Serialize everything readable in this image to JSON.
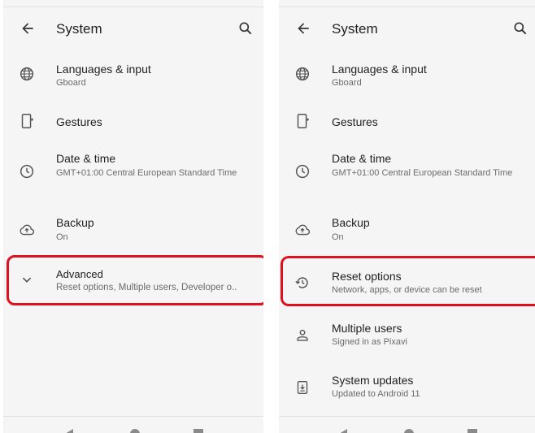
{
  "colors": {
    "highlight": "#e0101f",
    "background": "#f5f5f5",
    "text": "#1f1f1f",
    "subtext": "#6b6b6b"
  },
  "left": {
    "title": "System",
    "items": [
      {
        "icon": "globe-icon",
        "title": "Languages & input",
        "subtitle": "Gboard"
      },
      {
        "icon": "gestures-icon",
        "title": "Gestures",
        "subtitle": ""
      },
      {
        "icon": "clock-icon",
        "title": "Date & time",
        "subtitle": "GMT+01:00 Central European Standard Time"
      },
      {
        "icon": "cloud-upload-icon",
        "title": "Backup",
        "subtitle": "On"
      },
      {
        "icon": "chevron-down-icon",
        "title": "Advanced",
        "subtitle": "Reset options, Multiple users, Developer o.."
      }
    ]
  },
  "right": {
    "title": "System",
    "items": [
      {
        "icon": "globe-icon",
        "title": "Languages & input",
        "subtitle": "Gboard"
      },
      {
        "icon": "gestures-icon",
        "title": "Gestures",
        "subtitle": ""
      },
      {
        "icon": "clock-icon",
        "title": "Date & time",
        "subtitle": "GMT+01:00 Central European Standard Time"
      },
      {
        "icon": "cloud-upload-icon",
        "title": "Backup",
        "subtitle": "On"
      },
      {
        "icon": "restore-icon",
        "title": "Reset options",
        "subtitle": "Network, apps, or device can be reset"
      },
      {
        "icon": "person-icon",
        "title": "Multiple users",
        "subtitle": "Signed in as Pixavi"
      },
      {
        "icon": "system-update-icon",
        "title": "System updates",
        "subtitle": "Updated to Android 11"
      }
    ]
  }
}
